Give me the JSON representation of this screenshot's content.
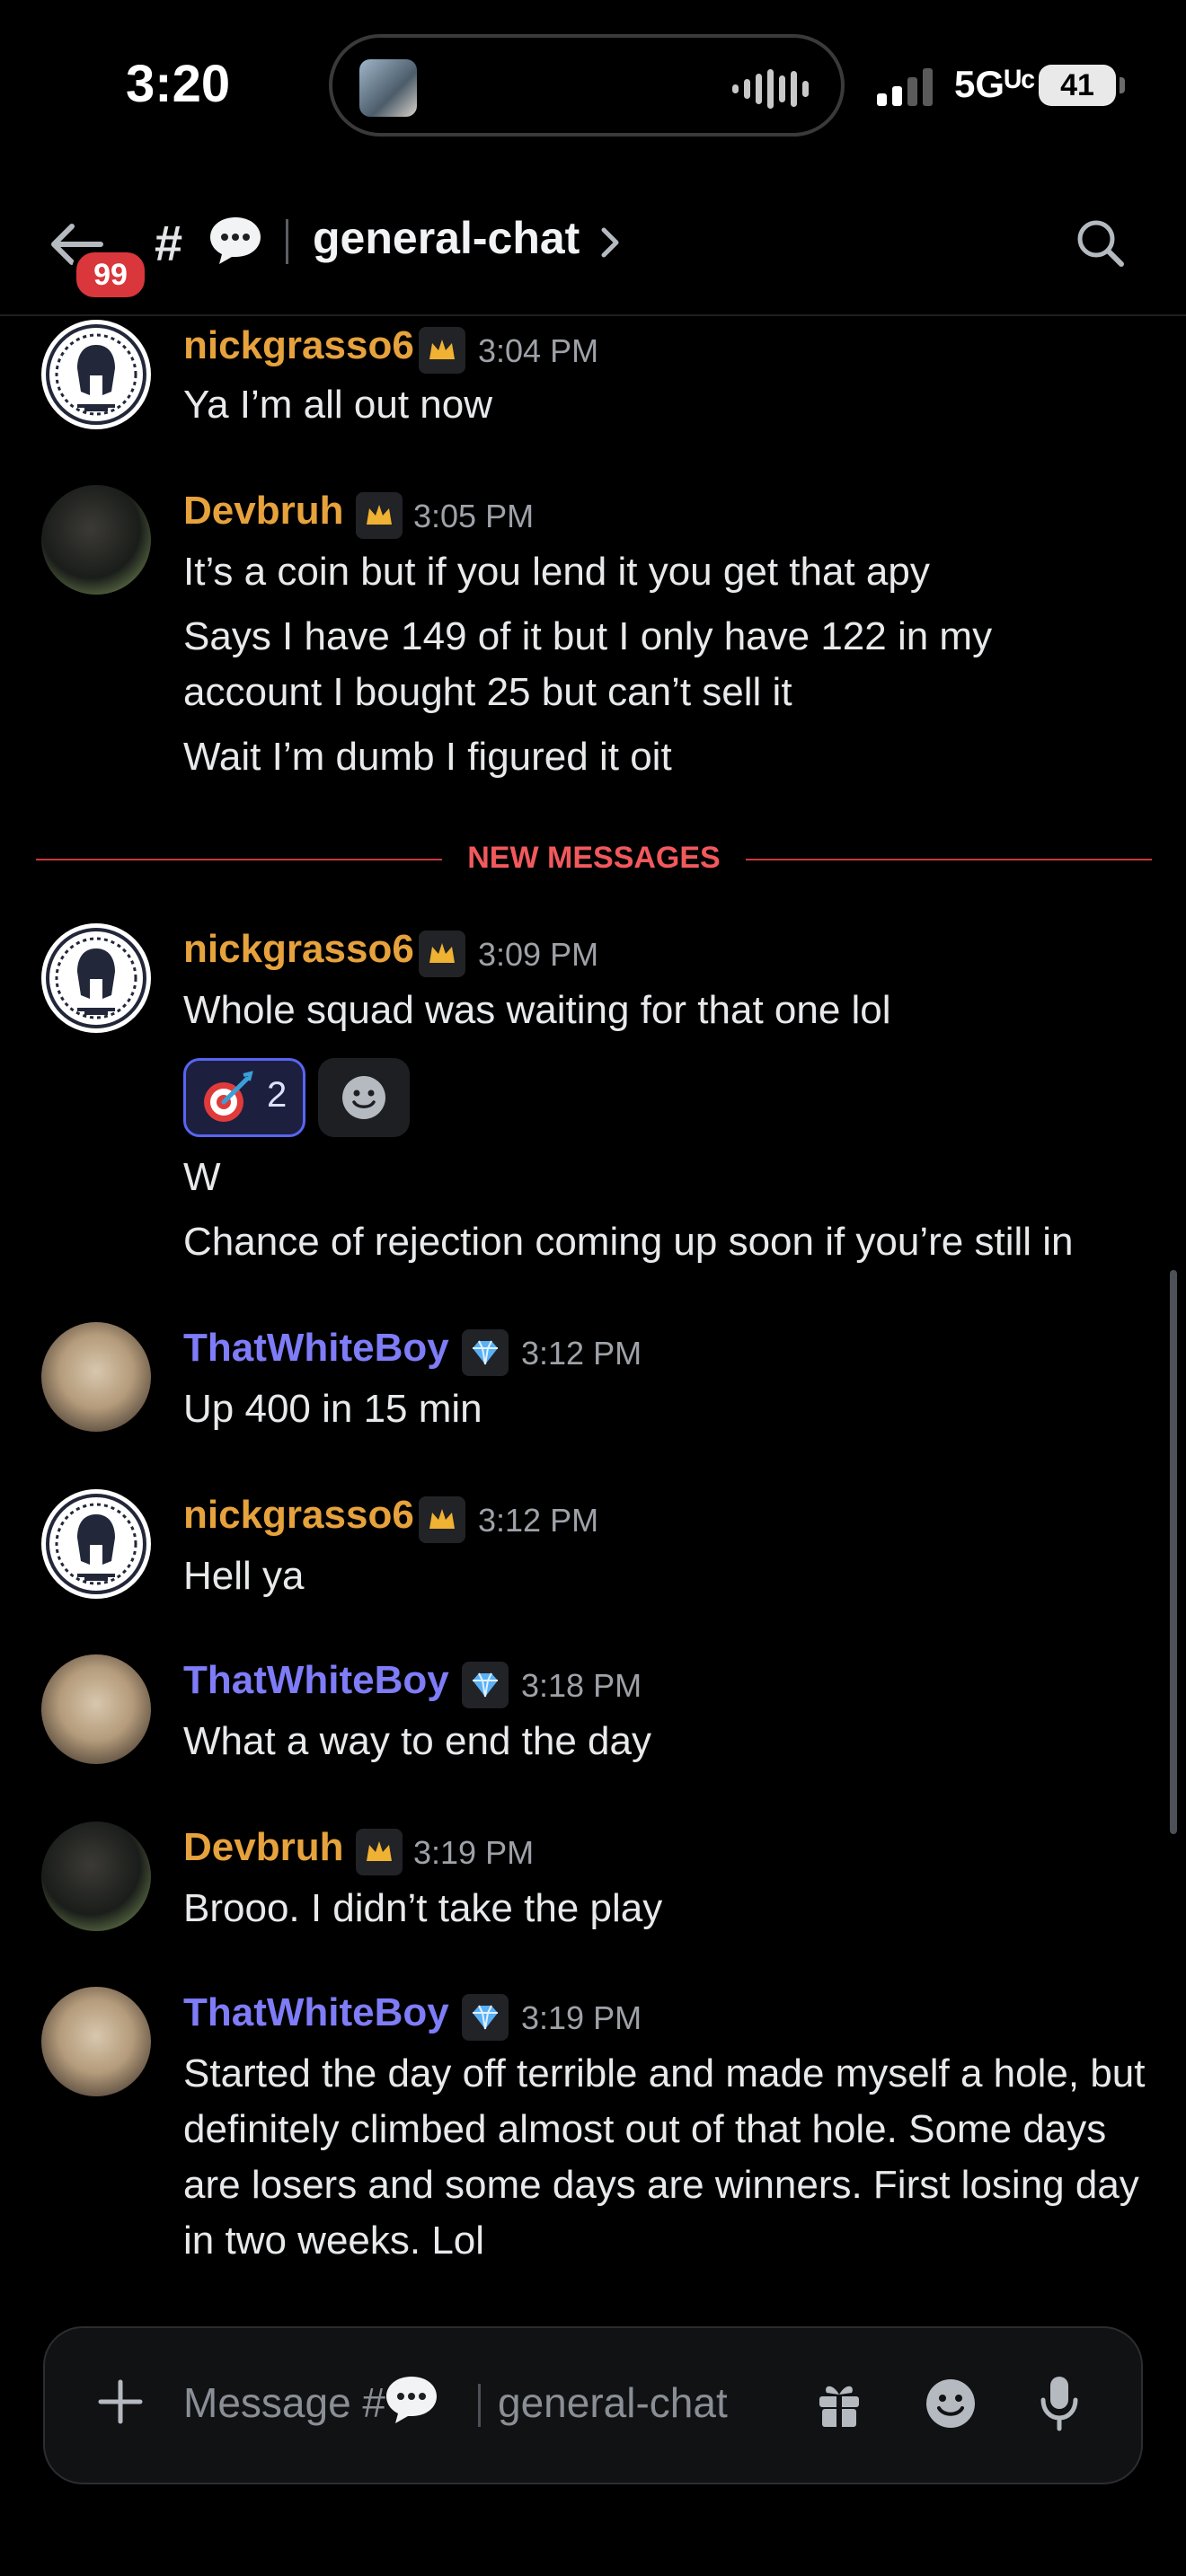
{
  "status_bar": {
    "time": "3:20",
    "network": "5Gᵁᶜ",
    "battery": "41"
  },
  "header": {
    "unread_badge": "99",
    "hash": "#",
    "channel_name": "general-chat"
  },
  "divider": {
    "label": "NEW MESSAGES"
  },
  "messages": [
    {
      "author": "nickgrasso6",
      "time": "3:04 PM",
      "role": "crown",
      "lines": [
        "Ya I’m all out now"
      ]
    },
    {
      "author": "Devbruh",
      "time": "3:05 PM",
      "role": "crown",
      "lines": [
        "It’s a coin but if you lend it you get that apy",
        "Says I have 149 of it but I only have 122 in my",
        "account I bought 25 but can’t sell it",
        "Wait I’m dumb I figured it oit"
      ]
    },
    {
      "author": "nickgrasso6",
      "time": "3:09 PM",
      "role": "crown",
      "lines": [
        "Whole squad was waiting for that one lol",
        "W",
        "Chance of rejection coming up soon if you’re still in"
      ],
      "reaction": {
        "emoji": "direct-hit",
        "count": "2"
      }
    },
    {
      "author": "ThatWhiteBoy",
      "time": "3:12 PM",
      "role": "diamond",
      "lines": [
        "Up 400 in 15 min"
      ]
    },
    {
      "author": "nickgrasso6",
      "time": "3:12 PM",
      "role": "crown",
      "lines": [
        "Hell ya"
      ]
    },
    {
      "author": "ThatWhiteBoy",
      "time": "3:18 PM",
      "role": "diamond",
      "lines": [
        "What a way to end the day"
      ]
    },
    {
      "author": "Devbruh",
      "time": "3:19 PM",
      "role": "crown",
      "lines": [
        "Brooo. I didn’t take the play"
      ]
    },
    {
      "author": "ThatWhiteBoy",
      "time": "3:19 PM",
      "role": "diamond",
      "text": "Started the day off terrible and made myself a hole, but definitely climbed almost out of that hole. Some days are losers and some days are winners. First losing day in two weeks. Lol"
    }
  ],
  "composer": {
    "placeholder_prefix": "Message #",
    "placeholder_channel": "general-chat"
  },
  "colors": {
    "username_gold": "#e6a23c",
    "username_blue": "#7e7cf7",
    "new_messages_red": "#f1595c",
    "badge_red": "#da373c",
    "reaction_blurple": "#5865f2"
  }
}
